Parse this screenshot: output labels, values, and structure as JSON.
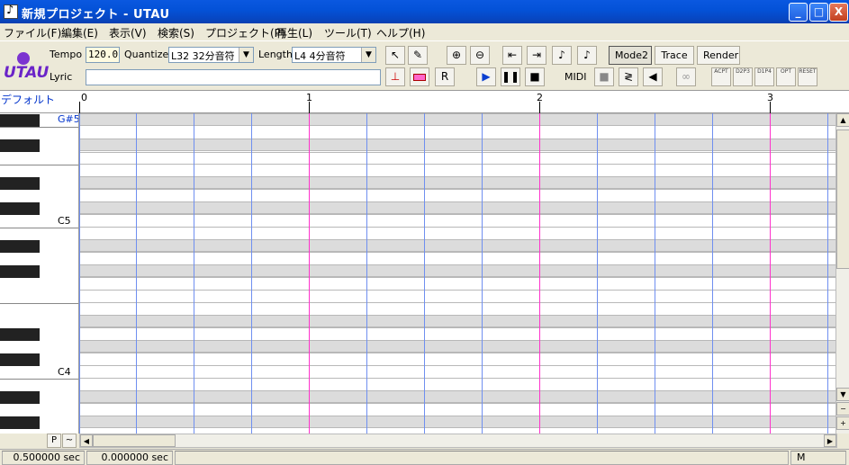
{
  "window": {
    "title": "新規プロジェクト - UTAU",
    "min_label": "_",
    "max_label": "□",
    "close_label": "X"
  },
  "menu": {
    "items": [
      "ファイル(F)",
      "編集(E)",
      "表示(V)",
      "検索(S)",
      "プロジェクト(P)",
      "再生(L)",
      "ツール(T)",
      "ヘルプ(H)"
    ]
  },
  "toolbar": {
    "logo_text": "UTAU",
    "tempo_label": "Tempo",
    "tempo_value": "120.0",
    "quantize_label": "Quantize",
    "quantize_value": "L32 32分音符",
    "length_label": "Length",
    "length_value": "L4  4分音符",
    "lyric_label": "Lyric",
    "lyric_value": "",
    "mode2_label": "Mode2",
    "trace_label": "Trace",
    "render_label": "Render",
    "midi_label": "MIDI",
    "env_labels": [
      "ACPT",
      "D2P3",
      "D1P4",
      "OPT",
      "RESET"
    ]
  },
  "track": {
    "name": "デフォルト",
    "bars": [
      "0",
      "1",
      "2",
      "3"
    ]
  },
  "piano": {
    "labels": [
      "G#5",
      "C5",
      "C4"
    ]
  },
  "bottom": {
    "p_label": "P",
    "tilde_label": "~"
  },
  "status": {
    "position_sec": "0.500000 sec",
    "time_sec": "0.000000 sec",
    "mode": "M"
  },
  "colors": {
    "bar_line": "#ff33cc",
    "beat_line": "#6f8ff0",
    "black_row": "#dcdcdc",
    "track_name": "#0033cc",
    "logo": "#6a23c8"
  }
}
